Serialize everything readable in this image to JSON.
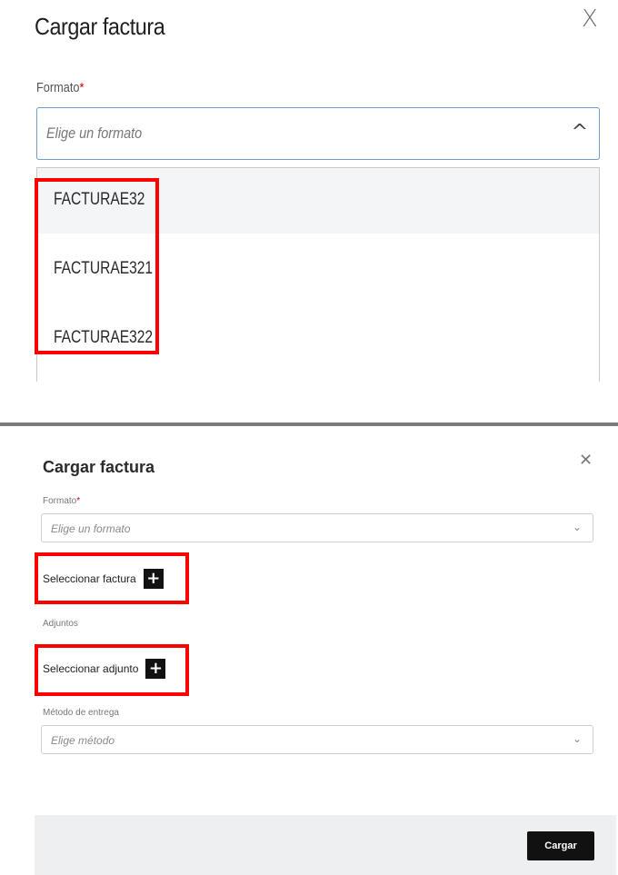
{
  "top": {
    "title": "Cargar factura",
    "close": "X",
    "format_label": "Formato",
    "required_mark": "*",
    "format_placeholder": "Elige un formato",
    "chevron": "^",
    "options": [
      "FACTURAE32",
      "FACTURAE321",
      "FACTURAE322"
    ]
  },
  "bottom": {
    "title": "Cargar factura",
    "close": "✕",
    "format_label": "Formato",
    "required_mark": "*",
    "format_placeholder": "Elige un formato",
    "chevron": "⌄",
    "select_invoice": "Seleccionar factura",
    "attachments_label": "Adjuntos",
    "select_attachment": "Seleccionar adjunto",
    "delivery_label": "Método de entrega",
    "delivery_placeholder": "Elige método",
    "submit": "Cargar",
    "plus": "+"
  },
  "colors": {
    "highlight": "#ff0000",
    "focus_border": "#6c9fc9",
    "button_bg": "#111111",
    "required": "#d40000"
  }
}
